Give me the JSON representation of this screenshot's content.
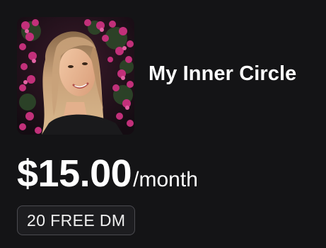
{
  "subscription": {
    "title": "My Inner Circle",
    "price": "$15.00",
    "period": "/month",
    "badge": "20 FREE DM"
  },
  "avatar": {
    "description_icon": "profile-photo"
  },
  "colors": {
    "background": "#141416",
    "text": "#ffffff",
    "badge_border": "#4b4b50",
    "flower_accent": "#c2307a"
  }
}
